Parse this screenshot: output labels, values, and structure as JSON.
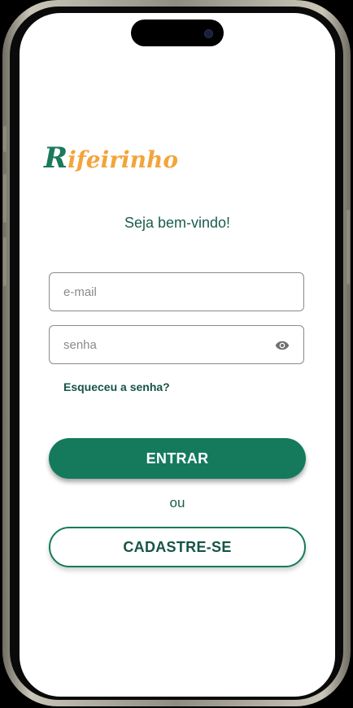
{
  "app": {
    "logo_prefix": "R",
    "logo_rest": "ifeirinho",
    "welcome": "Seja bem-vindo!"
  },
  "form": {
    "email_placeholder": "e-mail",
    "email_value": "",
    "password_placeholder": "senha",
    "password_value": "",
    "password_toggle_icon": "eye-icon",
    "forgot_label": "Esqueceu a senha?"
  },
  "actions": {
    "login_label": "ENTRAR",
    "separator": "ou",
    "signup_label": "CADASTRE-SE"
  },
  "colors": {
    "primary": "#157a5c",
    "accent": "#f3a43a",
    "text_dark": "#165447"
  }
}
